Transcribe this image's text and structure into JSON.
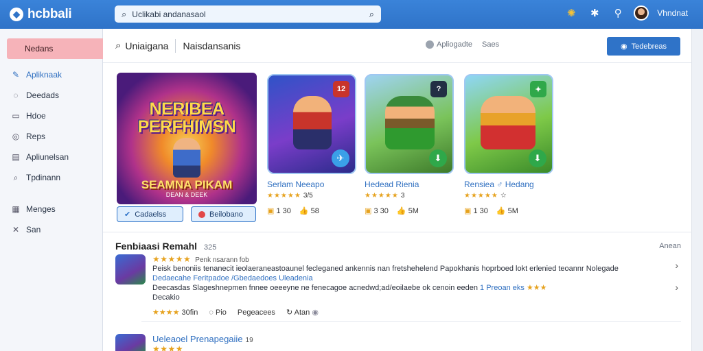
{
  "topbar": {
    "brand": "hcbbali",
    "search_placeholder": "Uclikabi andanasaol",
    "user_name": "Vhndnat"
  },
  "sidebar": {
    "items": [
      {
        "label": "Nedans",
        "icon": "home-icon"
      },
      {
        "label": "Apliknaak",
        "icon": "book-icon"
      },
      {
        "label": "Deedads",
        "icon": "chat-icon"
      },
      {
        "label": "Hdoe",
        "icon": "inbox-icon"
      },
      {
        "label": "Reps",
        "icon": "target-icon"
      },
      {
        "label": "Apliunelsan",
        "icon": "list-icon"
      },
      {
        "label": "Tpdinann",
        "icon": "search-icon"
      },
      {
        "label": "Menges",
        "icon": "grid-icon"
      },
      {
        "label": "San",
        "icon": "tools-icon"
      }
    ]
  },
  "subbar": {
    "tab1": "Uniaigana",
    "tab2": "Naisdansanis",
    "filter1": "Apliogadte",
    "filter2": "Saes",
    "button": "Tedebreas"
  },
  "featured": {
    "hero_title": "NERIBEA PERFHIMSN",
    "hero_subtitle": "SEAMNA PIKAM",
    "hero_small": "DEAN & DEEK",
    "button1": "Cadaelss",
    "button2": "Beilobano"
  },
  "cards": [
    {
      "title": "Serlam Neeapo",
      "stars": "★★★★★",
      "rating_label": "3/5",
      "m1": "1 30",
      "m2": "58",
      "badge": "12",
      "badge_color": "#c8342b"
    },
    {
      "title": "Hedead Rienia",
      "stars": "★★★★★",
      "rating_label": "3",
      "m1": "3 30",
      "m2": "5M",
      "badge": "?",
      "badge_color": "#222e44"
    },
    {
      "title": "Rensiea ♂ Hedang",
      "stars": "★★★★★",
      "rating_label": "☆",
      "m1": "1 30",
      "m2": "5M",
      "badge": "✦",
      "badge_color": "#2fa84a"
    }
  ],
  "reviews": {
    "title": "Fenbiaasi Remahl",
    "count": "325",
    "see_all": "Anean",
    "items": [
      {
        "who": "Penk nsarann fob",
        "line1": "Peisk benoniis tenanecit ieolaeraneastoaunel fecleganed ankennis nan fretshehelend Papokhanis hoprboed lokt erlenied teoannr Nolegade",
        "line2": "Dedaecahe Feritpadoe /Gbedaedoes Uleadenia",
        "line3_a": "Deecasdas Slageshnepmen fnnee oeeeyne ne fenecagoe acnedwd;ad/eoilaebe ok cenoin eeden",
        "line3_b": "1 Preoan eks",
        "line4": "Decakio",
        "votes": "30fin",
        "replies": "Pio",
        "action3": "Pegeacees",
        "action4": "Atan"
      },
      {
        "title": "Ueleaoel Prenapegaiie",
        "num": "19"
      }
    ]
  }
}
